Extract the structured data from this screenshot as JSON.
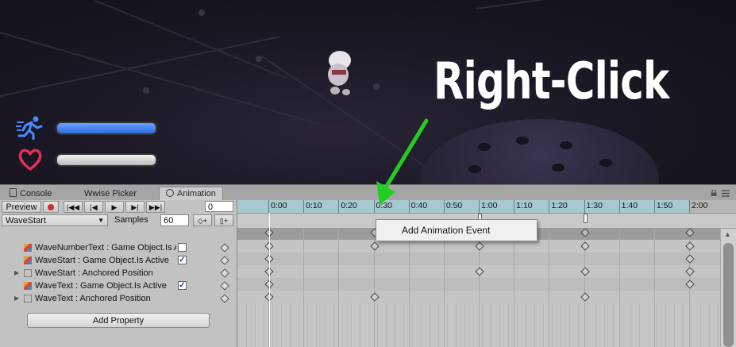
{
  "overlay": {
    "instruction": "Right-Click"
  },
  "game_view": {
    "hud": {
      "run_icon": "running-man-icon",
      "heart_icon": "heart-icon",
      "speed_bar_fill": 1.0,
      "health_bar_fill": 1.0,
      "speed_color": "#3b7cf0",
      "health_color": "#e03a5a"
    }
  },
  "tabs": [
    {
      "label": "Console",
      "icon": "console-icon"
    },
    {
      "label": "Wwise Picker"
    },
    {
      "label": "Animation",
      "icon": "clock-icon"
    }
  ],
  "toolbar": {
    "preview_label": "Preview",
    "frame_value": "0",
    "clip_name": "WaveStart",
    "samples_label": "Samples",
    "samples_value": "60"
  },
  "properties": [
    {
      "label": "WaveNumberText : Game Object.Is Active",
      "icon": "gameobject-icon",
      "foldout": false,
      "checkbox": true,
      "checked": false
    },
    {
      "label": "WaveStart : Game Object.Is Active",
      "icon": "gameobject-icon",
      "foldout": false,
      "checkbox": true,
      "checked": true
    },
    {
      "label": "WaveStart : Anchored Position",
      "icon": "recttransform-icon",
      "foldout": true,
      "checkbox": false
    },
    {
      "label": "WaveText : Game Object.Is Active",
      "icon": "gameobject-icon",
      "foldout": false,
      "checkbox": true,
      "checked": true
    },
    {
      "label": "WaveText : Anchored Position",
      "icon": "recttransform-icon",
      "foldout": true,
      "checkbox": false
    }
  ],
  "add_property_label": "Add Property",
  "timeline": {
    "ticks": [
      "0:00",
      "0:10",
      "0:20",
      "0:30",
      "0:40",
      "0:50",
      "1:00",
      "1:10",
      "1:20",
      "1:30",
      "1:40",
      "1:50",
      "2:00"
    ],
    "playhead_time": "0:00",
    "event_markers": [
      "1:00",
      "1:30"
    ],
    "summary_keys": [
      "0:00",
      "0:30",
      "1:30",
      "2:00"
    ],
    "row_keys": [
      [
        "0:00",
        "0:30",
        "1:00",
        "1:30",
        "2:00"
      ],
      [
        "0:00",
        "2:00"
      ],
      [
        "0:00",
        "1:00",
        "1:30",
        "2:00"
      ],
      [
        "0:00",
        "2:00"
      ],
      [
        "0:00",
        "0:30",
        "1:30"
      ]
    ]
  },
  "context_menu": {
    "items": [
      "Add Animation Event"
    ]
  }
}
